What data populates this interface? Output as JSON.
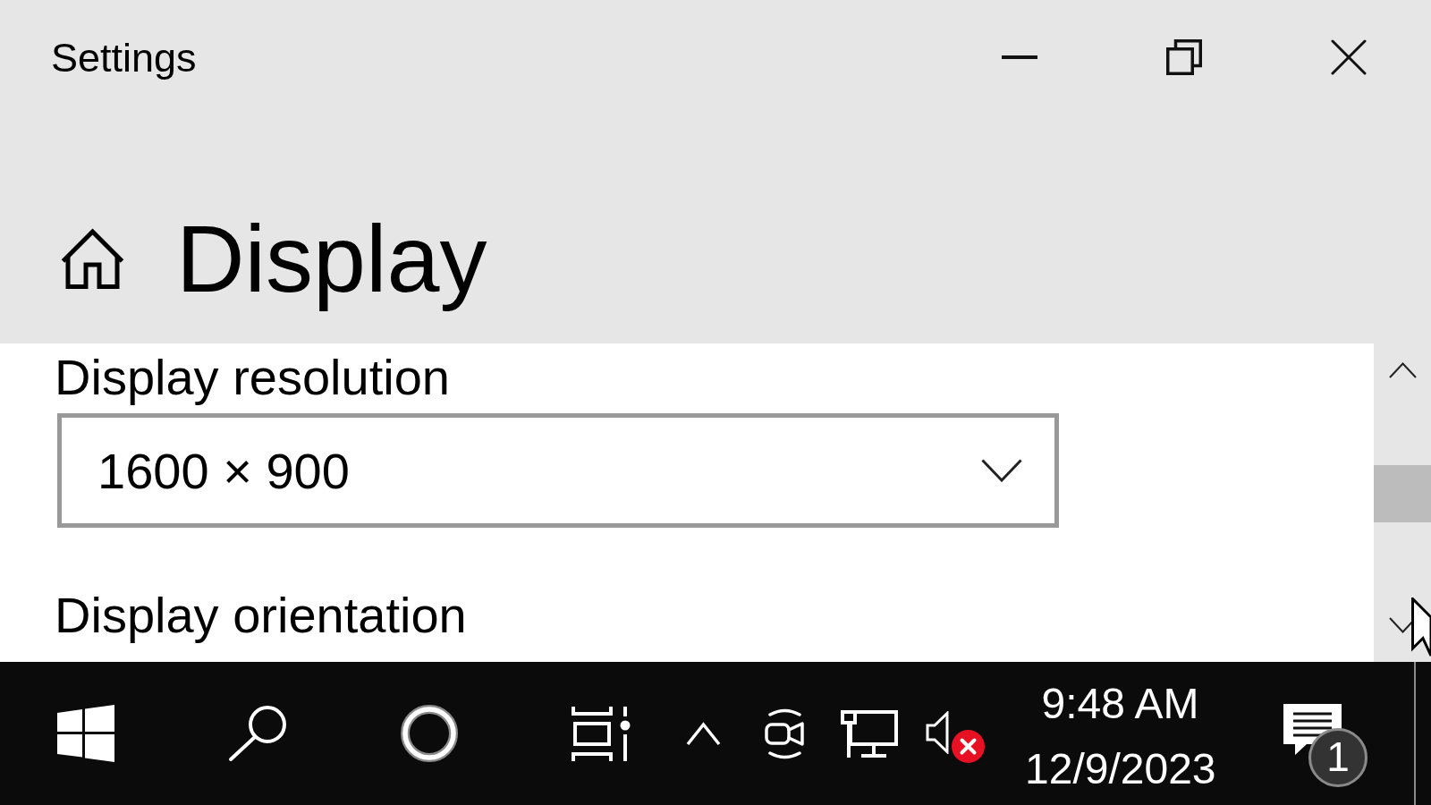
{
  "window": {
    "title": "Settings"
  },
  "page": {
    "title": "Display"
  },
  "settings": [
    {
      "kind": "label",
      "text": "Display resolution"
    },
    {
      "kind": "dropdown",
      "value": "1600 × 900"
    },
    {
      "kind": "label",
      "text": "Display orientation"
    }
  ],
  "taskbar": {
    "time": "9:48 AM",
    "date": "12/9/2023",
    "volume_muted": true,
    "notification_count": "1"
  }
}
